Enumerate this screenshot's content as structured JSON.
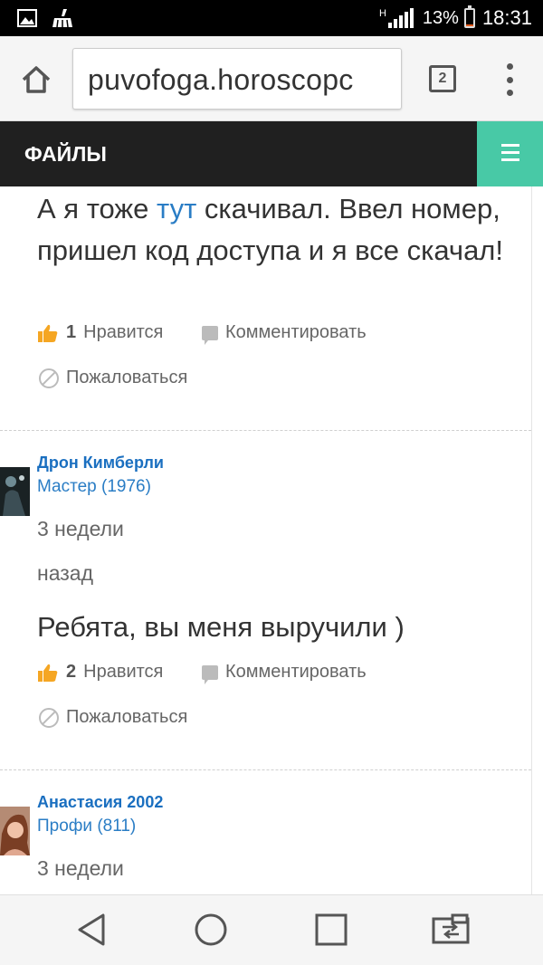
{
  "status_bar": {
    "battery": "13%",
    "battery_level": 0.13,
    "time": "18:31",
    "signal_label": "H",
    "icons": [
      "image-icon",
      "cleaner-icon"
    ]
  },
  "browser": {
    "url": "puvofoga.horoscopc",
    "tab_count": "2",
    "icons": [
      "home-icon",
      "overflow-menu-icon"
    ]
  },
  "site": {
    "title": "ФАЙЛЫ",
    "menu_icon": "hamburger-icon",
    "accent_color": "#48c9a6",
    "header_color": "#202020",
    "link_color": "#2a7dc5"
  },
  "posts": [
    {
      "text_before": "А я тоже ",
      "text_link": "тут",
      "text_after": " скачивал. Ввел номер, пришел код доступа и я все скачал!",
      "likes": "1",
      "like_label": "Нравится",
      "comment_label": "Комментировать",
      "report_label": "Пожаловаться"
    },
    {
      "author": "Дрон Кимберли",
      "rank": "Мастер (1976)",
      "time_line1": "3 недели",
      "time_line2": "назад",
      "text": "Ребята, вы меня выручили )",
      "likes": "2",
      "like_label": "Нравится",
      "comment_label": "Комментировать",
      "report_label": "Пожаловаться"
    },
    {
      "author": "Анастасия 2002",
      "rank": "Профи (811)",
      "time_line1": "3 недели"
    }
  ],
  "nav": {
    "icons": [
      "back-icon",
      "home-circle-icon",
      "recents-icon",
      "switch-apps-icon"
    ]
  }
}
